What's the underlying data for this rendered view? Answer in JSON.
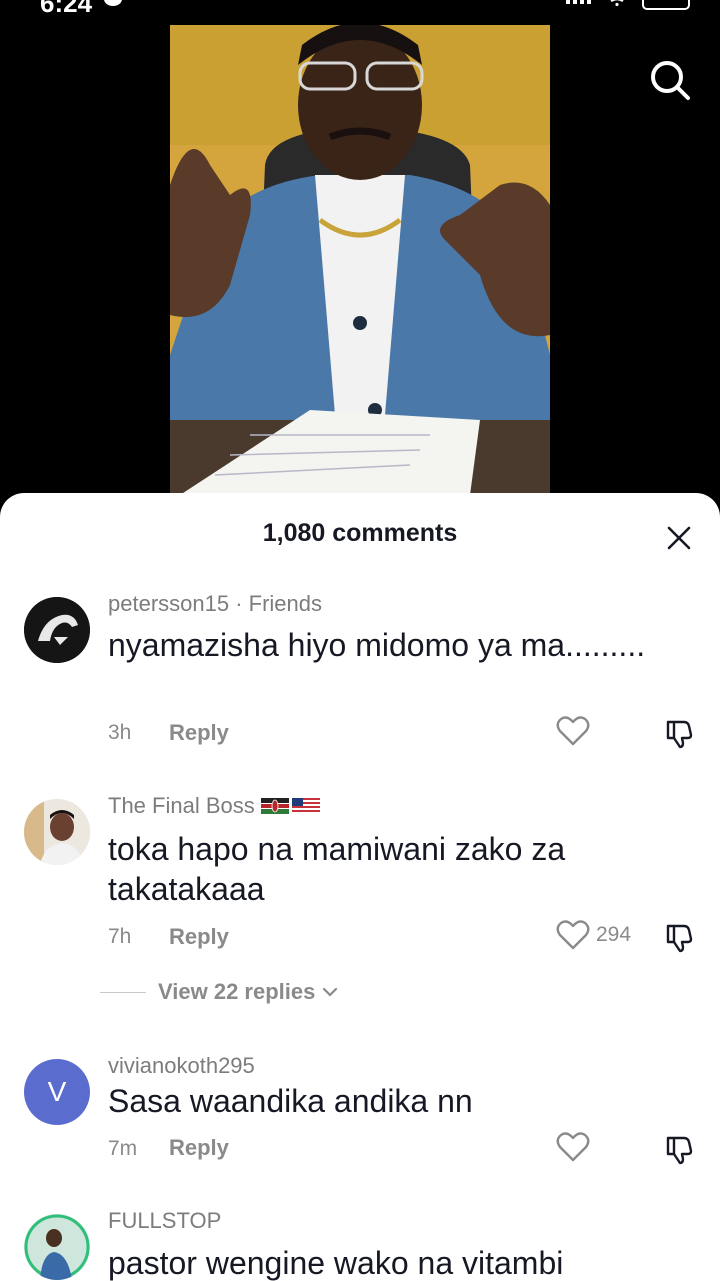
{
  "status_bar": {
    "time": "6:24",
    "battery": "90"
  },
  "comments_panel": {
    "title": "1,080 comments",
    "comments": [
      {
        "username": "petersson15 · Friends",
        "text": "nyamazisha hiyo midomo ya ma.........",
        "time": "3h",
        "reply_label": "Reply",
        "likes": ""
      },
      {
        "username": "The Final Boss",
        "text": "toka hapo na mamiwani zako za takatakaaa",
        "time": "7h",
        "reply_label": "Reply",
        "likes": "294",
        "view_replies": "View 22 replies"
      },
      {
        "username": "vivianokoth295",
        "avatar_letter": "V",
        "text": "Sasa waandika andika nn",
        "time": "7m",
        "reply_label": "Reply",
        "likes": ""
      },
      {
        "username": "FULLSTOP",
        "text": "pastor wengine wako na vitambi",
        "time": "",
        "reply_label": "",
        "likes": ""
      }
    ]
  },
  "icons": {
    "search": "search-icon",
    "close": "close-icon",
    "like": "heart-icon",
    "dislike": "thumbs-down-icon",
    "chevron": "chevron-down-icon"
  },
  "colors": {
    "avatar_v_bg": "#5b6ccf",
    "text_primary": "#161823",
    "text_secondary": "#8a8a8a"
  }
}
